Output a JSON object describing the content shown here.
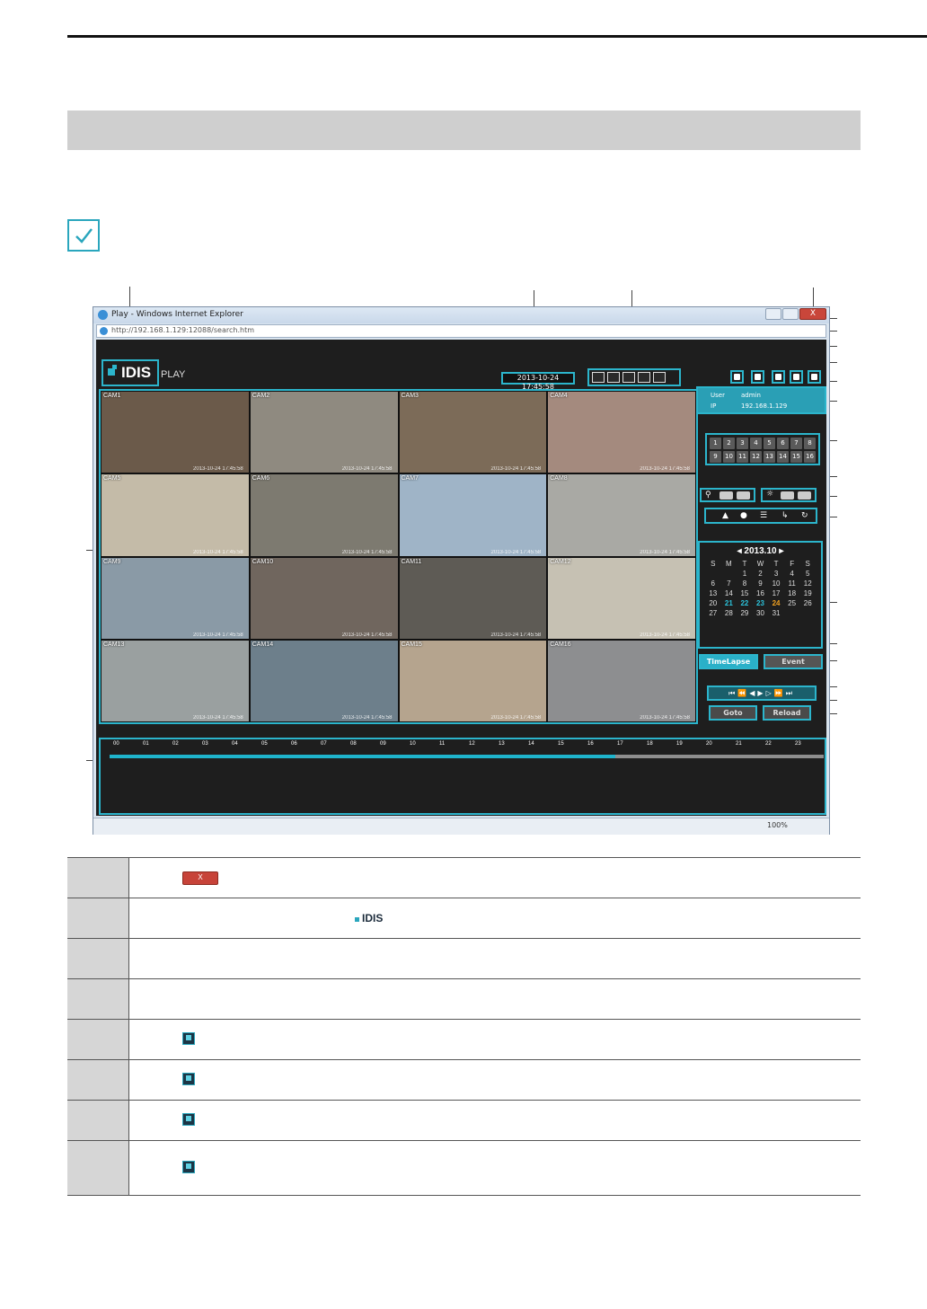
{
  "browser": {
    "title": "Play - Windows Internet Explorer",
    "url": "http://192.168.1.129:12088/search.htm",
    "close_label": "X",
    "zoom": "100%"
  },
  "app": {
    "logo": "IDIS",
    "product": "PLAY",
    "datetime": "2013-10-24 17:45:58",
    "user_label": "User",
    "user_value": "admin",
    "ip_label": "IP",
    "ip_value": "192.168.1.129",
    "cameras": [
      {
        "label": "CAM1",
        "ts": "2013-10-24 17:45:58",
        "color": "#6b5a4a"
      },
      {
        "label": "CAM2",
        "ts": "2013-10-24 17:45:58",
        "color": "#8f8a80"
      },
      {
        "label": "CAM3",
        "ts": "2013-10-24 17:45:58",
        "color": "#7c6b58"
      },
      {
        "label": "CAM4",
        "ts": "2013-10-24 17:45:58",
        "color": "#a48a7e"
      },
      {
        "label": "CAM5",
        "ts": "2013-10-24 17:45:58",
        "color": "#c4bba8"
      },
      {
        "label": "CAM6",
        "ts": "2013-10-24 17:45:58",
        "color": "#7d7a70"
      },
      {
        "label": "CAM7",
        "ts": "2013-10-24 17:45:58",
        "color": "#9fb4c7"
      },
      {
        "label": "CAM8",
        "ts": "2013-10-24 17:45:58",
        "color": "#a9a9a4"
      },
      {
        "label": "CAM9",
        "ts": "2013-10-24 17:45:58",
        "color": "#8a9aa6"
      },
      {
        "label": "CAM10",
        "ts": "2013-10-24 17:45:58",
        "color": "#70665e"
      },
      {
        "label": "CAM11",
        "ts": "2013-10-24 17:45:58",
        "color": "#5e5b55"
      },
      {
        "label": "CAM12",
        "ts": "2013-10-24 17:45:58",
        "color": "#c6c1b3"
      },
      {
        "label": "CAM13",
        "ts": "2013-10-24 17:45:58",
        "color": "#9aa0a0"
      },
      {
        "label": "CAM14",
        "ts": "2013-10-24 17:45:58",
        "color": "#6d7f8b"
      },
      {
        "label": "CAM15",
        "ts": "2013-10-24 17:45:58",
        "color": "#b5a48e"
      },
      {
        "label": "CAM16",
        "ts": "2013-10-24 17:45:58",
        "color": "#8d8e90"
      }
    ],
    "channels": [
      "1",
      "2",
      "3",
      "4",
      "5",
      "6",
      "7",
      "8",
      "9",
      "10",
      "11",
      "12",
      "13",
      "14",
      "15",
      "16"
    ],
    "calendar": {
      "month": "2013.10",
      "weekdays": [
        "S",
        "M",
        "T",
        "W",
        "T",
        "F",
        "S"
      ],
      "days": [
        "",
        "",
        "1",
        "2",
        "3",
        "4",
        "5",
        "6",
        "7",
        "8",
        "9",
        "10",
        "11",
        "12",
        "13",
        "14",
        "15",
        "16",
        "17",
        "18",
        "19",
        "20",
        "21",
        "22",
        "23",
        "24",
        "25",
        "26",
        "27",
        "28",
        "29",
        "30",
        "31",
        "",
        "",
        ""
      ]
    },
    "tabs": {
      "timelapse": "TimeLapse",
      "event": "Event"
    },
    "buttons": {
      "goto": "Goto",
      "reload": "Reload"
    },
    "hours": [
      "00",
      "01",
      "02",
      "03",
      "04",
      "05",
      "06",
      "07",
      "08",
      "09",
      "10",
      "11",
      "12",
      "13",
      "14",
      "15",
      "16",
      "17",
      "18",
      "19",
      "20",
      "21",
      "22",
      "23"
    ],
    "recorded_fraction": 0.708
  }
}
